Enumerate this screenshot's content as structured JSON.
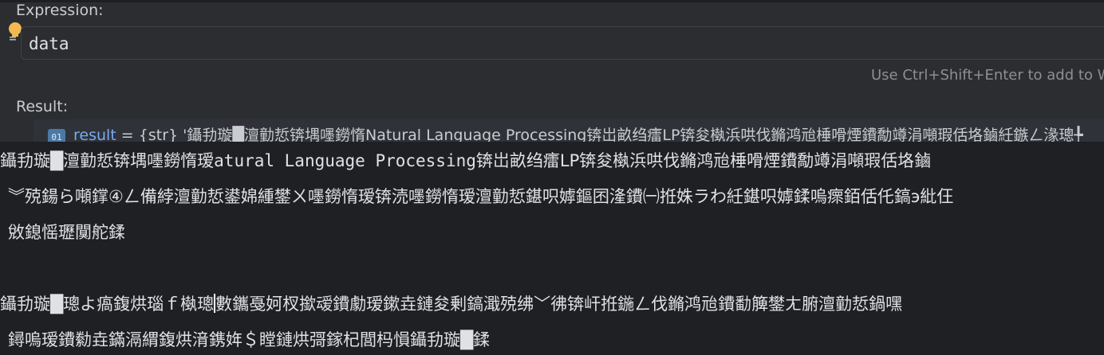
{
  "expression": {
    "label": "Expression:",
    "value": "data",
    "hint": "Use Ctrl+Shift+Enter to add to W"
  },
  "result": {
    "label": "Result:",
    "icon_text": "01",
    "name": "result",
    "value_preview": " = {str} '鑷劧璇█澶勭悊锛堣嚜鐒惰Natural Language Processing锛岀畝绉癗LP锛夋槸浜哄伐鏅鸿兘棰嗗煙鐨勪竴涓噸瑕佸垎鏀紝鏃ㄥ湪璁╄"
  },
  "tooltip": {
    "line1_a": "鑷劧璇█澶勭悊锛堣嚜鐒惰瑷",
    "line1_b": "atural Language Processing",
    "line1_c": "锛岀畝绉癗LP锛夋槸浜哄伐鏅鸿兘棰嗗煙鐨勪竴涓噸瑕佸垎鏀",
    "line2": "︾殑鍚ら噸鐣④ㄥ備綍澶勭悊鍙婂緟鐢ㄨ嚜鐒惰瑷锛涜嚜鐒惰瑷澶勭悊鍖呮嫭鏂囨湰鐨㈠拰姝ラわ紝鍖呮嫭鍒嗚瘝銆佸仛鎬э紕仼",
    "line3": "敓鎴愮瓑闃舵鍒",
    "line4_a": "鑷劧璇█璁よ瘑鍑烘瑙ｆ槸璁",
    "line4_b": "數鑴戞妸杈撳叆鐨勮瑷鏉垚鏈夋剰鎬濈殑绋﹀彿锛屽拰鍦ㄥ伐鏅鸿兘鐨勫簲鐢ㄤ腑澶勭悊鍋嘿",
    "line5": "鐞嗚瑷鐨勬垚鏋滆緭鍑烘湇鎸姩＄瞠鏈烘彁鎵杞閭杩愪鑷劧璇█鍒"
  },
  "colors": {
    "background": "#2b2d30",
    "tooltip_background": "#1f2023",
    "result_name": "#79a9f3",
    "bulb": "#f2b950",
    "hint_text": "#8c8f94"
  },
  "icons": {
    "bulb": "lightbulb-icon",
    "result_type": "field-icon"
  }
}
